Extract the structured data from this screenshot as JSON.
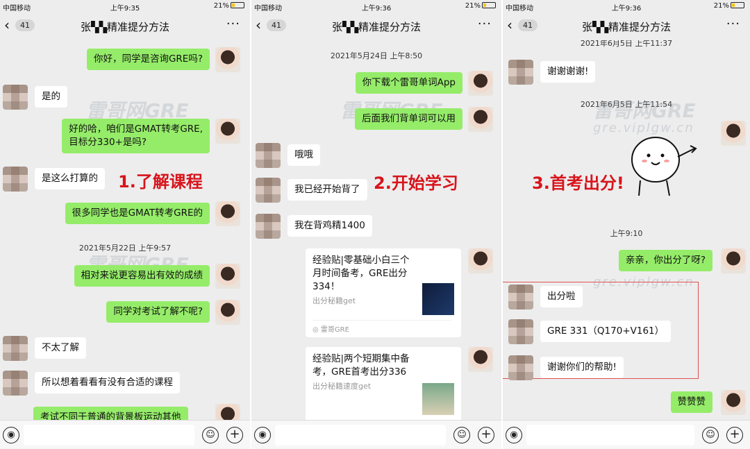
{
  "status": {
    "carrier": "中国移动",
    "battery": "21%"
  },
  "panels": [
    {
      "time": "上午9:35",
      "badge": "41",
      "title": "张▚▚精准提分方法",
      "label": "1.了解课程",
      "watermark": {
        "main": "雷哥网GRE",
        "sub": "gre.viplgw.cn"
      },
      "messages": {
        "m1": "你好，同学是咨询GRE吗?",
        "m2": "是的",
        "m3a": "好的哈，咱们是GMAT转考GRE,",
        "m3b": "目标分330+是吗?",
        "m4": "是这么打算的",
        "m5": "很多同学也是GMAT转考GRE的",
        "ts1": "2021年5月22日 上午9:57",
        "m6": "相对来说更容易出有效的成绩",
        "m7": "同学对考试了解不呢?",
        "m8": "不太了解",
        "m9": "所以想着看看有没有合适的课程",
        "m10": "考试不同于普通的背景板运动其他"
      }
    },
    {
      "time": "上午9:36",
      "badge": "41",
      "title": "张▚▚精准提分方法",
      "label": "2.开始学习",
      "watermark": {
        "main": "雷哥网GRE",
        "sub": "gre.viplgw.cn"
      },
      "messages": {
        "ts1": "2021年5月24日 上午8:50",
        "m1": "你下载个雷哥单词App",
        "m2": "后面我们背单词可以用",
        "m3": "哦哦",
        "m4": "我已经开始背了",
        "m5": "我在背鸡精1400",
        "card1": {
          "title": "经验贴|零基础小白三个月时间备考，GRE出分334！",
          "sub": "出分秘籍get",
          "source": "雷哥GRE"
        },
        "card2": {
          "title": "经验贴|两个短期集中备考，GRE首考出分336",
          "sub": "出分秘籍速度get"
        }
      }
    },
    {
      "time": "上午9:36",
      "badge": "41",
      "title": "张▚▚精准提分方法",
      "label": "3.首考出分!",
      "watermark": {
        "main": "雷哥网GRE",
        "sub": "gre.viplgw.cn"
      },
      "messages": {
        "ts0": "2021年6月5日 上午11:37",
        "m1": "谢谢谢谢!",
        "ts1": "2021年6月5日 上午11:54",
        "ts2": "上午9:10",
        "m2": "亲亲，你出分了呀?",
        "m3": "出分啦",
        "m4": "GRE 331（Q170+V161）",
        "m5": "谢谢你们的帮助!",
        "m6": "赞赞赞"
      }
    }
  ],
  "colors": {
    "me_bubble": "#95ec69",
    "label_red": "#d8141c",
    "chat_bg": "#ededed"
  }
}
